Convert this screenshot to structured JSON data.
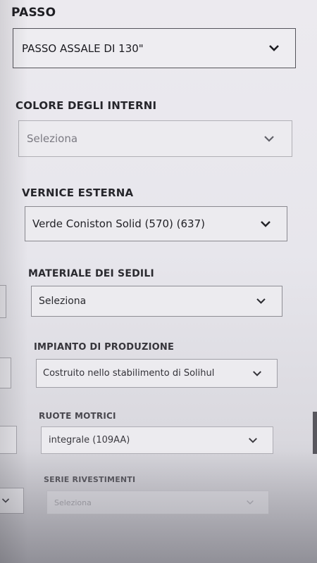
{
  "sections": [
    {
      "label": "PASSO",
      "value": "PASSO ASSALE DI 130\""
    },
    {
      "label": "COLORE DEGLI INTERNI",
      "value": "Seleziona"
    },
    {
      "label": "VERNICE ESTERNA",
      "value": "Verde Coniston Solid (570) (637)"
    },
    {
      "label": "MATERIALE DEI SEDILI",
      "value": "Seleziona"
    },
    {
      "label": "IMPIANTO DI PRODUZIONE",
      "value": "Costruito nello stabilimento di Solihul"
    },
    {
      "label": "RUOTE MOTRICI",
      "value": "integrale (109AA)"
    },
    {
      "label": "SERIE RIVESTIMENTI",
      "value": "Seleziona"
    }
  ],
  "icons": {
    "dropdown": "chevron-down-icon"
  }
}
